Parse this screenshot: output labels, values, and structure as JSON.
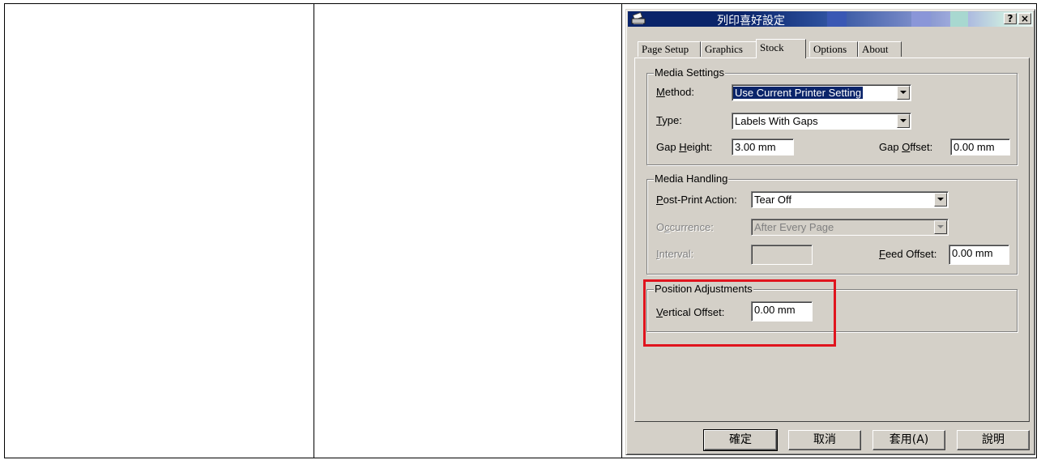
{
  "dialog": {
    "title": "列印喜好設定",
    "help_button": "?",
    "close_button": "×"
  },
  "tabs": [
    "Page Setup",
    "Graphics",
    "Stock",
    "Options",
    "About"
  ],
  "active_tab": "Stock",
  "media_settings": {
    "legend": "Media Settings",
    "method_prefix": "M",
    "method_rest": "ethod:",
    "method_value": "Use Current Printer Setting",
    "type_prefix": "T",
    "type_rest": "ype:",
    "type_value": "Labels With Gaps",
    "gap_height_pre": "Gap ",
    "gap_height_u": "H",
    "gap_height_post": "eight:",
    "gap_height_value": "3.00 mm",
    "gap_offset_pre": "Gap ",
    "gap_offset_u": "O",
    "gap_offset_post": "ffset:",
    "gap_offset_value": "0.00 mm"
  },
  "media_handling": {
    "legend": "Media Handling",
    "post_print_u": "P",
    "post_print_rest": "ost-Print Action:",
    "post_print_value": "Tear Off",
    "occurrence_pre": "O",
    "occurrence_u": "c",
    "occurrence_post": "currence:",
    "occurrence_value": "After Every Page",
    "interval_u": "I",
    "interval_rest": "nterval:",
    "interval_value": "",
    "feed_offset_u": "F",
    "feed_offset_rest": "eed Offset:",
    "feed_offset_value": "0.00 mm"
  },
  "position_adjustments": {
    "legend": "Position Adjustments",
    "vertical_offset_u": "V",
    "vertical_offset_rest": "ertical Offset:",
    "vertical_offset_value": "0.00 mm"
  },
  "buttons": {
    "ok": "確定",
    "cancel": "取消",
    "apply": "套用(A)",
    "help": "說明"
  },
  "colors": {
    "titlebar": "#0a246a",
    "highlight_box": "#e0141e",
    "face": "#d4d0c8"
  }
}
